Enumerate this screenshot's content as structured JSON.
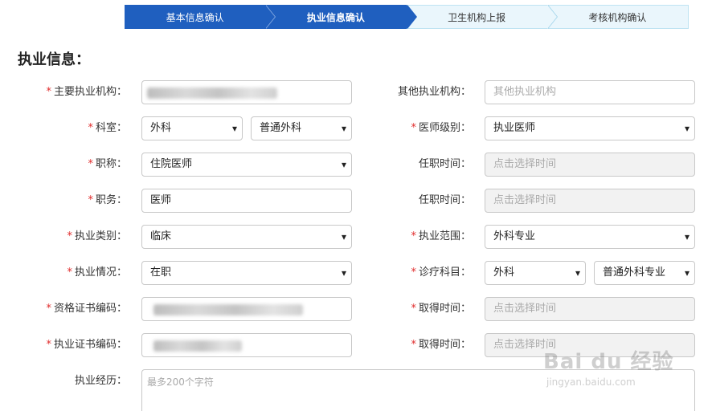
{
  "steps": [
    {
      "label": "基本信息确认"
    },
    {
      "label": "执业信息确认"
    },
    {
      "label": "卫生机构上报"
    },
    {
      "label": "考核机构确认"
    }
  ],
  "section_title": "执业信息：",
  "required_mark": "*",
  "form": {
    "main_institution": {
      "label": "主要执业机构："
    },
    "other_institution": {
      "label": "其他执业机构：",
      "placeholder": "其他执业机构"
    },
    "department": {
      "label": "科室：",
      "value": "外科",
      "sub_value": "普通外科"
    },
    "doctor_level": {
      "label": "医师级别：",
      "value": "执业医师"
    },
    "title": {
      "label": "职称：",
      "value": "住院医师"
    },
    "title_time": {
      "label": "任职时间：",
      "placeholder": "点击选择时间"
    },
    "position": {
      "label": "职务：",
      "value": "医师"
    },
    "position_time": {
      "label": "任职时间：",
      "placeholder": "点击选择时间"
    },
    "practice_category": {
      "label": "执业类别：",
      "value": "临床"
    },
    "practice_scope": {
      "label": "执业范围：",
      "value": "外科专业"
    },
    "practice_status": {
      "label": "执业情况：",
      "value": "在职"
    },
    "diagnosis_subject": {
      "label": "诊疗科目：",
      "value": "外科",
      "sub_value": "普通外科专业"
    },
    "qualification_cert": {
      "label": "资格证书编码："
    },
    "qualification_time": {
      "label": "取得时间：",
      "placeholder": "点击选择时间"
    },
    "practice_cert": {
      "label": "执业证书编码："
    },
    "practice_cert_time": {
      "label": "取得时间：",
      "placeholder": "点击选择时间"
    },
    "experience": {
      "label": "执业经历：",
      "placeholder": "最多200个字符"
    }
  },
  "watermark": {
    "main": "Bai du 经验",
    "sub": "jingyan.baidu.com"
  }
}
